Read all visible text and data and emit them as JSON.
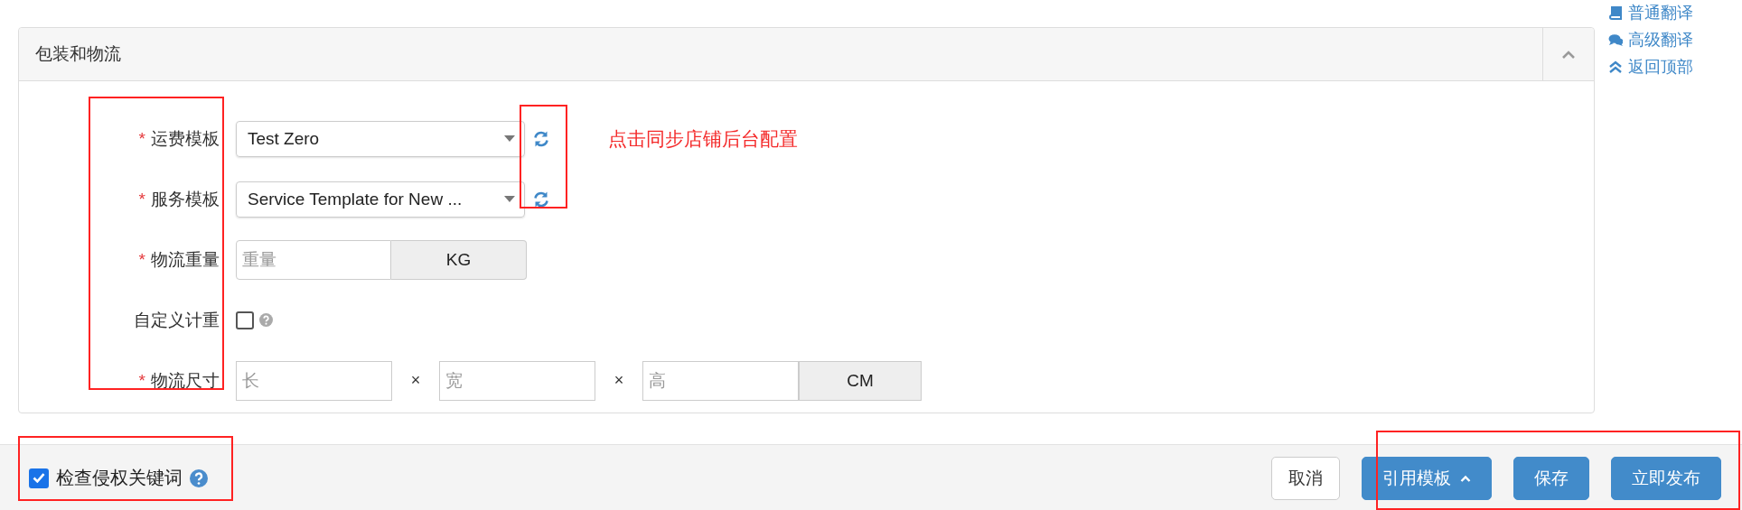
{
  "side_links": [
    {
      "kind": "book",
      "label": "普通翻译"
    },
    {
      "kind": "comments",
      "label": "高级翻译"
    },
    {
      "kind": "up",
      "label": "返回顶部"
    }
  ],
  "panel": {
    "title": "包装和物流",
    "expanded": true,
    "required_mark": "*",
    "fields": [
      {
        "kind": "select",
        "label": "运费模板",
        "required": true,
        "value": "Test Zero",
        "sync": true
      },
      {
        "kind": "select",
        "label": "服务模板",
        "required": true,
        "value": "Service Template for New ...",
        "sync": true
      },
      {
        "kind": "unit",
        "label": "物流重量",
        "required": true,
        "placeholder": "重量",
        "unit": "KG"
      },
      {
        "kind": "checkbox",
        "label": "自定义计重",
        "required": false,
        "checked": false
      },
      {
        "kind": "dimensions",
        "label": "物流尺寸",
        "required": true,
        "inputs": [
          {
            "placeholder": "长"
          },
          {
            "placeholder": "宽"
          },
          {
            "placeholder": "高"
          }
        ],
        "separators": [
          "×",
          "×"
        ],
        "unit": "CM"
      }
    ]
  },
  "note": "点击同步店铺后台配置",
  "footer": {
    "check": {
      "label": "检查侵权关键词",
      "checked": true
    },
    "buttons": [
      {
        "label": "取消",
        "kind": "default",
        "caret": false
      },
      {
        "label": "引用模板",
        "kind": "primary",
        "caret": true
      },
      {
        "label": "保存",
        "kind": "primary",
        "caret": false
      },
      {
        "label": "立即发布",
        "kind": "primary",
        "caret": false
      }
    ]
  }
}
